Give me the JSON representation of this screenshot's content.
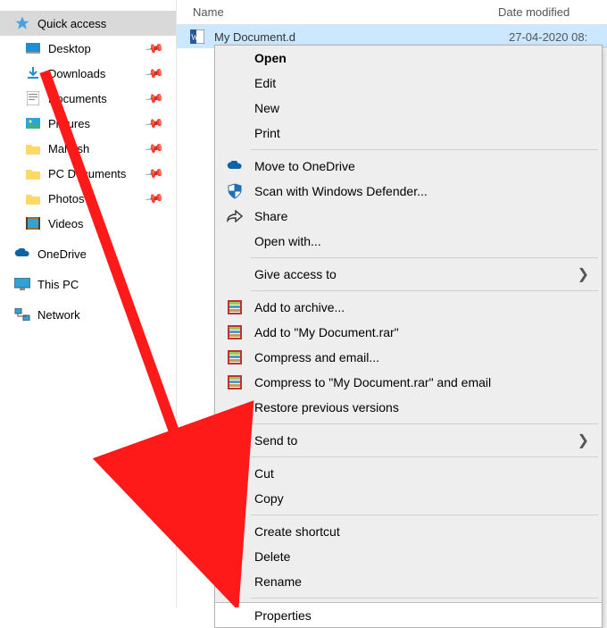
{
  "columns": {
    "name": "Name",
    "date": "Date modified"
  },
  "sidebar": {
    "quick_access": "Quick access",
    "items": [
      {
        "label": "Desktop",
        "pinned": true
      },
      {
        "label": "Downloads",
        "pinned": true
      },
      {
        "label": "Documents",
        "pinned": true
      },
      {
        "label": "Pictures",
        "pinned": true
      },
      {
        "label": "Mahesh",
        "pinned": true
      },
      {
        "label": "PC Documents",
        "pinned": true
      },
      {
        "label": "Photos",
        "pinned": true
      },
      {
        "label": "Videos",
        "pinned": false
      }
    ],
    "onedrive": "OneDrive",
    "thispc": "This PC",
    "network": "Network"
  },
  "file": {
    "name": "My Document.d",
    "date": "27-04-2020 08:"
  },
  "menu": {
    "open": "Open",
    "edit": "Edit",
    "new": "New",
    "print": "Print",
    "onedrive": "Move to OneDrive",
    "defender": "Scan with Windows Defender...",
    "share": "Share",
    "openwith": "Open with...",
    "giveaccess": "Give access to",
    "addarchive": "Add to archive...",
    "addto": "Add to \"My Document.rar\"",
    "compressemail": "Compress and email...",
    "compresstoemail": "Compress to \"My Document.rar\" and email",
    "restore": "Restore previous versions",
    "sendto": "Send to",
    "cut": "Cut",
    "copy": "Copy",
    "createshortcut": "Create shortcut",
    "delete": "Delete",
    "rename": "Rename",
    "properties": "Properties"
  }
}
